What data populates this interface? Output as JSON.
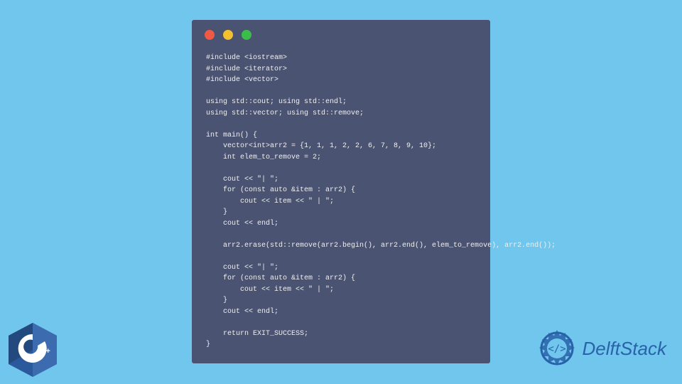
{
  "code": {
    "lines": "#include <iostream>\n#include <iterator>\n#include <vector>\n\nusing std::cout; using std::endl;\nusing std::vector; using std::remove;\n\nint main() {\n    vector<int>arr2 = {1, 1, 1, 2, 2, 6, 7, 8, 9, 10};\n    int elem_to_remove = 2;\n\n    cout << \"| \";\n    for (const auto &item : arr2) {\n        cout << item << \" | \";\n    }\n    cout << endl;\n\n    arr2.erase(std::remove(arr2.begin(), arr2.end(), elem_to_remove), arr2.end());\n\n    cout << \"| \";\n    for (const auto &item : arr2) {\n        cout << item << \" | \";\n    }\n    cout << endl;\n\n    return EXIT_SUCCESS;\n}"
  },
  "brand": {
    "name": "DelftStack",
    "cpp_label": "C++"
  },
  "colors": {
    "background": "#71c6ed",
    "window_bg": "#4a5372",
    "code_text": "#f0f0f0",
    "brand_blue": "#2862a8",
    "cpp_blue": "#2b5a9c"
  }
}
